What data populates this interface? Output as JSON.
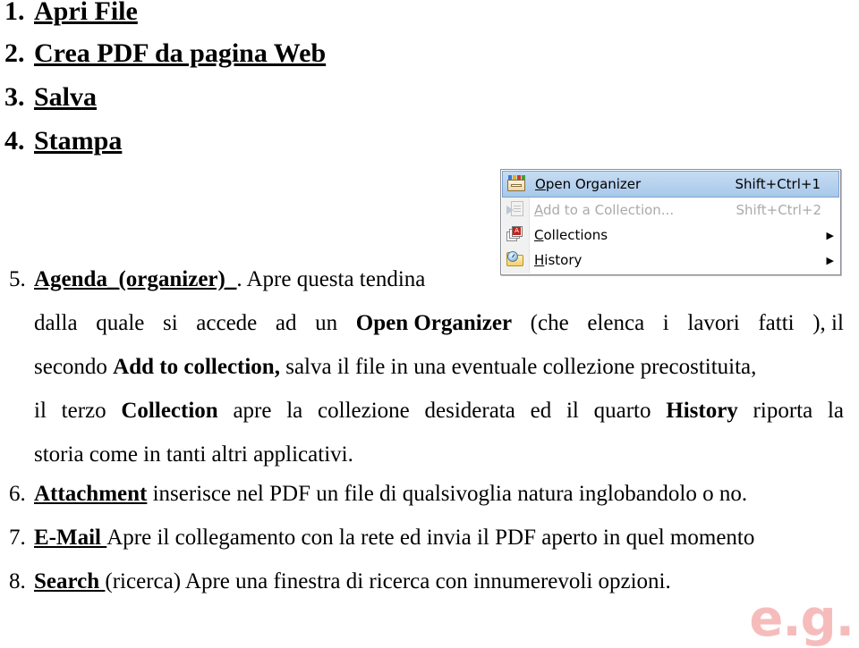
{
  "document": {
    "list_items": [
      {
        "number": "1.",
        "headline": "Apri File"
      },
      {
        "number": "2.",
        "headline": "Crea PDF da pagina Web"
      },
      {
        "number": "3.",
        "headline": "Salva"
      },
      {
        "number": "4.",
        "headline": "Stampa"
      }
    ],
    "item5": {
      "number": "5.",
      "headline": "Agenda_(organizer)_",
      "line1_rest": ". Apre questa tendina",
      "line2_a": "dalla",
      "line2_b": "quale",
      "line2_c": "si",
      "line2_d": "accede",
      "line2_e": "ad",
      "line2_f": "un",
      "line2_bold": "Open Organizer",
      "line2_g": "(che",
      "line2_h": "elenca",
      "line2_i": "i",
      "line2_j": "lavori",
      "line2_k": "fatti",
      "line2_l": "), il",
      "line3_a": "secondo",
      "line3_bold": "Add to collection,",
      "line3_b": "salva il file in una eventuale collezione precostituita,",
      "line4_a": "il",
      "line4_b": "terzo",
      "line4_bold1": "Collection",
      "line4_c": "apre",
      "line4_d": "la",
      "line4_e": "collezione",
      "line4_f": "desiderata",
      "line4_g": "ed",
      "line4_h": "il",
      "line4_i": "quarto",
      "line4_bold2": "History",
      "line4_j": "riporta",
      "line4_k": "la",
      "line5": "storia come in tanti altri applicativi."
    },
    "item6": {
      "number": "6.",
      "headline": "Attachment",
      "text": " inserisce nel PDF un file di qualsivoglia natura inglobandolo o no."
    },
    "item7": {
      "number": "7.",
      "headline": "E-Mail ",
      "text": " Apre il collegamento con la rete ed invia il PDF aperto in quel momento"
    },
    "item8": {
      "number": "8.",
      "headline": "Search ",
      "text": " (ricerca) Apre una finestra di ricerca con innumerevoli  opzioni."
    }
  },
  "context_menu": {
    "items": [
      {
        "icon": "organizer-icon",
        "mnemonic": "O",
        "label_rest": "pen Organizer",
        "shortcut": "Shift+Ctrl+1",
        "arrow": "",
        "state": "selected"
      },
      {
        "icon": "add-to-collection-icon",
        "mnemonic": "A",
        "label_rest": "dd to a Collection...",
        "shortcut": "Shift+Ctrl+2",
        "arrow": "",
        "state": "disabled"
      },
      {
        "icon": "collections-icon",
        "mnemonic": "C",
        "label_rest": "ollections",
        "shortcut": "",
        "arrow": "▶",
        "state": "normal"
      },
      {
        "icon": "history-icon",
        "mnemonic": "H",
        "label_rest": "istory",
        "shortcut": "",
        "arrow": "▶",
        "state": "normal"
      }
    ]
  },
  "watermark": {
    "text": "e.g."
  },
  "colors": {
    "menu_selection": "#a8c8ea",
    "menu_border": "#8c8f94",
    "disabled_text": "#aaaaaa",
    "watermark": "#f6bcbc"
  }
}
